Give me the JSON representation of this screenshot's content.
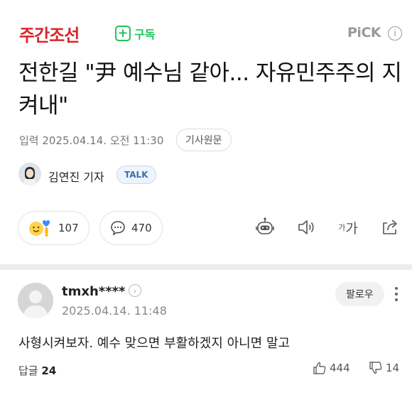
{
  "header": {
    "press_name": "주간조선",
    "subscribe_label": "구독",
    "pick_label": "PiCK",
    "pick_help": "i"
  },
  "article": {
    "title": "전한길 \"尹 예수님 같아... 자유민주주의 지켜내\"",
    "meta": "입력 2025.04.14. 오전 11:30",
    "original_label": "기사원문",
    "reporter": "김연진 기자",
    "talk_label": "TALK"
  },
  "reactions": {
    "emoji_count": "107",
    "comment_count": "470",
    "font_size_label_small": "가",
    "font_size_label_large": "가"
  },
  "comment": {
    "username": "tmxh****",
    "date": "2025.04.14. 11:48",
    "follow_label": "팔로우",
    "text": "사형시켜보자. 예수 맞으면 부활하겠지 아니면 말고",
    "replies_label": "답글",
    "replies_count": "24",
    "likes": "444",
    "dislikes": "14"
  }
}
